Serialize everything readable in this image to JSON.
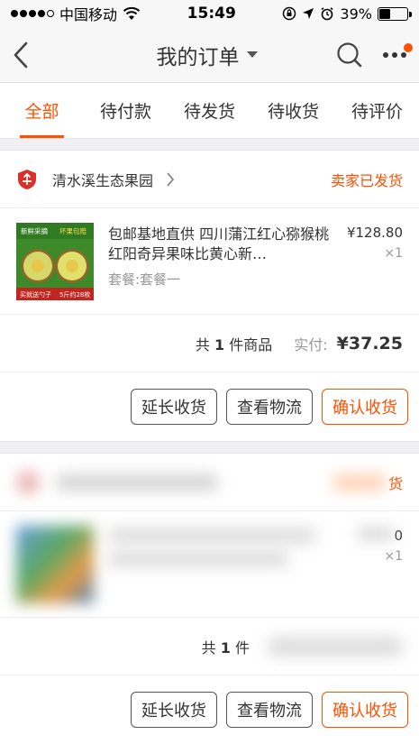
{
  "status_bar": {
    "carrier": "中国移动",
    "time": "15:49",
    "battery": "39%",
    "battery_level": 0.39
  },
  "nav": {
    "title": "我的订单"
  },
  "tabs": [
    {
      "label": "全部",
      "active": true
    },
    {
      "label": "待付款",
      "active": false
    },
    {
      "label": "待发货",
      "active": false
    },
    {
      "label": "待收货",
      "active": false
    },
    {
      "label": "待评价",
      "active": false
    }
  ],
  "orders": [
    {
      "shop_name": "清水溪生态果园",
      "status": "卖家已发货",
      "item": {
        "title": "包邮基地直供 四川蒲江红心猕猴桃 红阳奇异果味比黄心新…",
        "spec": "套餐:套餐一",
        "price": "¥128.80",
        "qty": "×1",
        "thumb_texts": [
          "新鲜采摘",
          "坏果包赔",
          "买就送勺子",
          "5斤约28枚"
        ]
      },
      "total": {
        "prefix": "共",
        "count": "1",
        "suffix": "件商品",
        "paid_label": "实付:",
        "paid_amount": "¥37.25"
      },
      "actions": [
        "延长收货",
        "查看物流",
        "确认收货"
      ]
    },
    {
      "shop_name": "",
      "status": "货",
      "item": {
        "title": "",
        "spec": "",
        "price": "0",
        "qty": "×1"
      },
      "total": {
        "prefix": "共",
        "count": "1",
        "suffix": "件"
      },
      "actions": [
        "延长收货",
        "查看物流",
        "确认收货"
      ]
    }
  ],
  "colors": {
    "accent": "#ff5000",
    "background": "#efeff4"
  }
}
